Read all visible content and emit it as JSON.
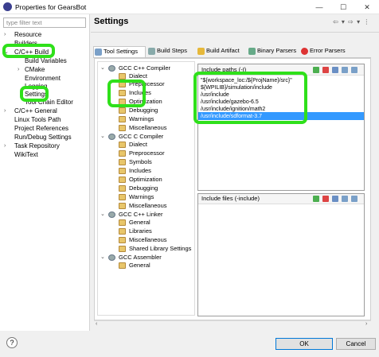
{
  "window": {
    "title": "Properties for GearsBot",
    "min": "—",
    "max": "☐",
    "close": "✕"
  },
  "filter": {
    "placeholder": "type filter text"
  },
  "left_tree": {
    "resource": "Resource",
    "builders": "Builders",
    "cpp_build": "C/C++ Build",
    "build_variables": "Build Variables",
    "cmake": "CMake",
    "environment": "Environment",
    "logging": "Logging",
    "settings": "Settings",
    "tool_chain_editor": "Tool Chain Editor",
    "cpp_general": "C/C++ General",
    "linux_tools_path": "Linux Tools Path",
    "project_references": "Project References",
    "run_debug_settings": "Run/Debug Settings",
    "task_repository": "Task Repository",
    "wikitext": "WikiText"
  },
  "header": {
    "title": "Settings"
  },
  "tabs": {
    "tool_settings": "Tool Settings",
    "build_steps": "Build Steps",
    "build_artifact": "Build Artifact",
    "binary_parsers": "Binary Parsers",
    "error_parsers": "Error Parsers"
  },
  "tool_tree": {
    "gcc_cpp_compiler": "GCC C++ Compiler",
    "dialect1": "Dialect",
    "preprocessor1": "Preprocessor",
    "includes1": "Includes",
    "optimization1": "Optimization",
    "debugging1": "Debugging",
    "warnings1": "Warnings",
    "misc1": "Miscellaneous",
    "gcc_c_compiler": "GCC C Compiler",
    "dialect2": "Dialect",
    "preprocessor2": "Preprocessor",
    "symbols2": "Symbols",
    "includes2": "Includes",
    "optimization2": "Optimization",
    "debugging2": "Debugging",
    "warnings2": "Warnings",
    "misc2": "Miscellaneous",
    "gcc_cpp_linker": "GCC C++ Linker",
    "general3": "General",
    "libraries3": "Libraries",
    "misc3": "Miscellaneous",
    "shared_lib3": "Shared Library Settings",
    "gcc_assembler": "GCC Assembler",
    "general4": "General"
  },
  "include_paths": {
    "label": "Include paths (-I)",
    "items": [
      "\"${workspace_loc:/${ProjName}/src}\"",
      "${WPILIB}/simulation/include",
      "/usr/include",
      "/usr/include/gazebo-6.5",
      "/usr/include/ignition/math2",
      "/usr/include/sdformat-3.7"
    ]
  },
  "include_files": {
    "label": "Include files (-include)"
  },
  "buttons": {
    "help": "?",
    "ok": "OK",
    "cancel": "Cancel"
  },
  "colors": {
    "highlight": "#2fe01a",
    "selection": "#3399ff"
  }
}
